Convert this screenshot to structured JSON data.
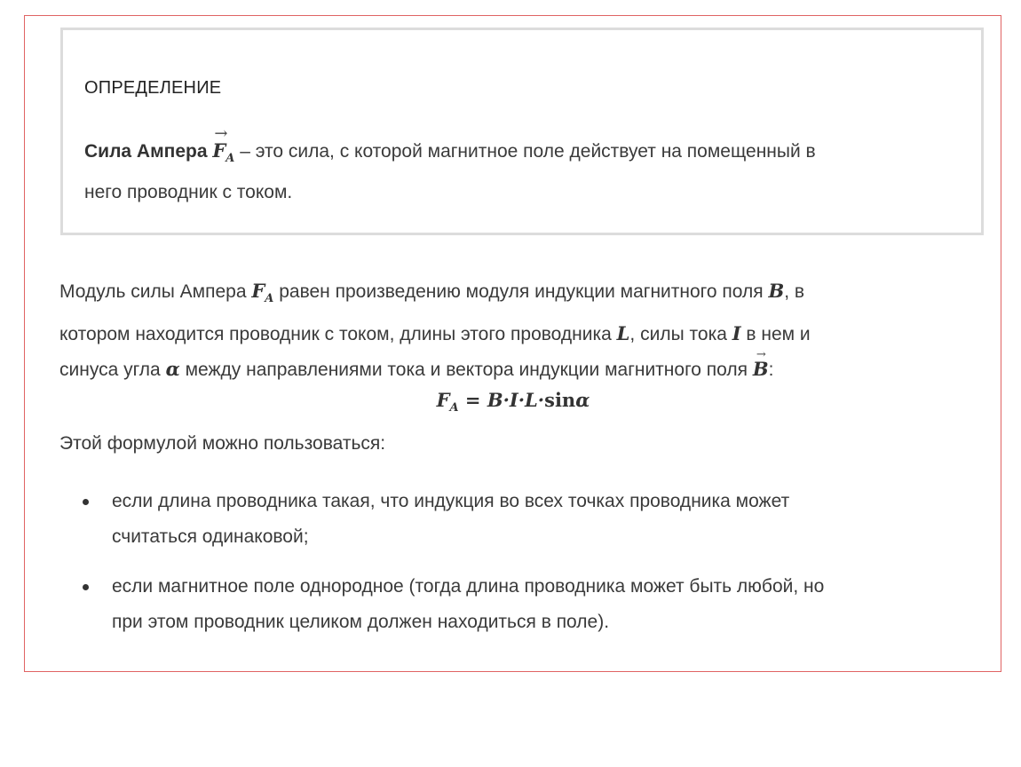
{
  "definition": {
    "heading": "ОПРЕДЕЛЕНИЕ",
    "term": "Сила Ампера",
    "symbol": "F",
    "symbol_sub": "A",
    "text_line1": " – это сила, с которой магнитное поле действует на помещенный в",
    "text_line2": "него проводник с током."
  },
  "paragraph": {
    "p1": "Модуль силы Ампера ",
    "p2": " равен произведению модуля индукции магнитного поля ",
    "p3": ", в",
    "p4": "котором находится проводник с током, длины этого проводника ",
    "p5": ", силы тока ",
    "p6": " в нем и",
    "p7": "синуса угла ",
    "p8": " между направлениями тока и вектора индукции магнитного поля ",
    "p9": ":",
    "sym_F": "F",
    "sym_A": "A",
    "sym_B": "B",
    "sym_L": "L",
    "sym_I": "I",
    "sym_alpha": "α"
  },
  "formula": {
    "lhs": "F",
    "lhs_sub": "A",
    "eq": " = ",
    "rhs": "B·I·L·",
    "func": "sin",
    "arg": "α"
  },
  "usage_intro": "Этой формулой можно пользоваться:",
  "conditions": [
    {
      "line1": "если длина проводника такая, что индукция во всех точках проводника может",
      "line2": "считаться одинаковой;"
    },
    {
      "line1": "если магнитное поле однородное (тогда длина проводника может быть любой, но",
      "line2": "при этом проводник целиком должен находиться в поле)."
    }
  ],
  "arrow_glyph": "→",
  "colors": {
    "frame_border": "#e06464",
    "definition_border": "#dcdcdc",
    "text": "#3a3a3a"
  }
}
